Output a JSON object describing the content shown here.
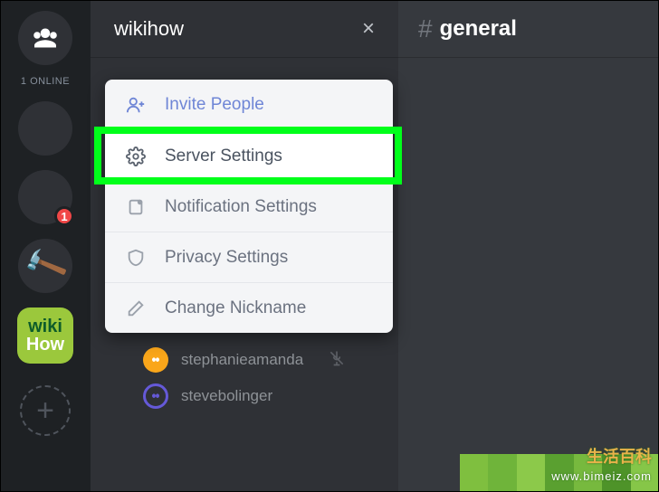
{
  "rail": {
    "online_label": "1 ONLINE",
    "badge_count": "1",
    "wikihow_top": "wiki",
    "wikihow_bottom": "How",
    "add_glyph": "+"
  },
  "sidebar": {
    "server_name": "wikihow",
    "close_glyph": "×"
  },
  "dropdown": {
    "items": [
      {
        "label": "Invite People"
      },
      {
        "label": "Server Settings"
      },
      {
        "label": "Notification Settings"
      },
      {
        "label": "Privacy Settings"
      },
      {
        "label": "Change Nickname"
      }
    ]
  },
  "members": [
    {
      "name": "stephanieamanda",
      "muted": true
    },
    {
      "name": "stevebolinger",
      "muted": false
    }
  ],
  "main": {
    "hash": "#",
    "channel": "general"
  },
  "watermark": {
    "brand": "生活百科",
    "url": "www.bimeiz.com"
  }
}
